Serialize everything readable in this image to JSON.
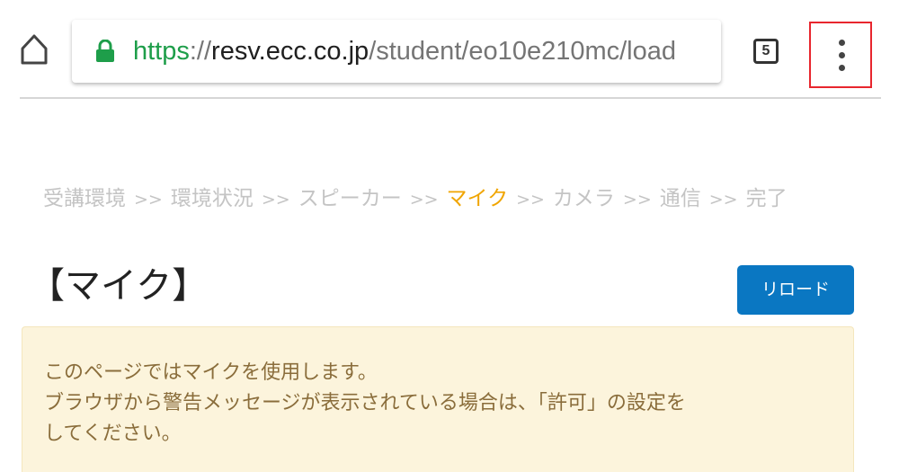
{
  "browser": {
    "url": {
      "scheme": "https",
      "separator": "://",
      "host": "resv.ecc.co.jp",
      "path": "/student/eo10e210mc/load"
    },
    "tab_count": "5",
    "icons": {
      "home": "home-icon",
      "lock": "lock-icon",
      "tabs": "tab-switcher-icon",
      "menu": "more-vert-icon"
    },
    "colors": {
      "secure_scheme": "#1e9e4a",
      "menu_highlight": "#e8262e"
    }
  },
  "breadcrumb": {
    "separator": ">>",
    "steps": [
      {
        "label": "受講環境",
        "active": false
      },
      {
        "label": "環境状況",
        "active": false
      },
      {
        "label": "スピーカー",
        "active": false
      },
      {
        "label": "マイク",
        "active": true
      },
      {
        "label": "カメラ",
        "active": false
      },
      {
        "label": "通信",
        "active": false
      },
      {
        "label": "完了",
        "active": false
      }
    ],
    "active_color": "#f0a500"
  },
  "page": {
    "title": "【マイク】",
    "reload_label": "リロード",
    "reload_color": "#0a77c2"
  },
  "notice": {
    "lines": [
      "このページではマイクを使用します。",
      "ブラウザから警告メッセージが表示されている場合は、「許可」の設定を",
      "してください。"
    ],
    "background": "#fcf4dc",
    "text_color": "#8a6d3b"
  }
}
